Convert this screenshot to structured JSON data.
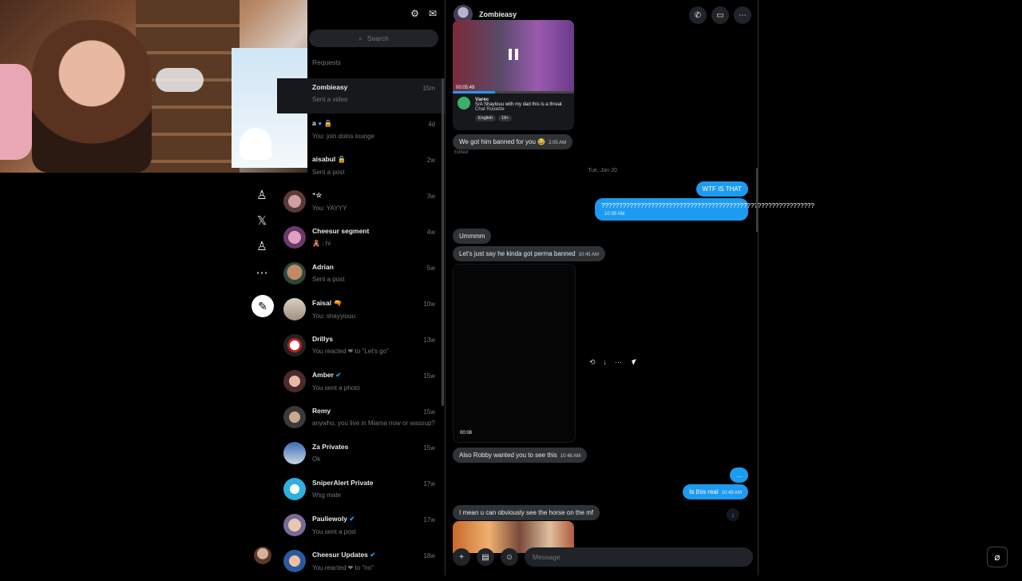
{
  "list": {
    "search_placeholder": "Search",
    "requests_label": "Requests",
    "conversations": [
      {
        "name": "Zombieasy",
        "preview": "Sent a video",
        "time": "15m"
      },
      {
        "name": "a",
        "preview": "You: join dolos lounge",
        "time": "4d"
      },
      {
        "name": "aisabul",
        "preview": "Sent a post",
        "time": "2w"
      },
      {
        "name": "",
        "preview": "You: YAYYY",
        "time": "3w"
      },
      {
        "name": "Cheesur segment",
        "preview": ": hi",
        "time": "4w"
      },
      {
        "name": "Adrian",
        "preview": "Sent a post",
        "time": "5w"
      },
      {
        "name": "Faisal",
        "preview": "You: shayyiouu",
        "time": "10w"
      },
      {
        "name": "Drillys",
        "preview": "You reacted ❤ to \"Let's go\"",
        "time": "13w"
      },
      {
        "name": "Amber",
        "preview": "You sent a photo",
        "time": "15w"
      },
      {
        "name": "Remy",
        "preview": "anywho, you live in Miama now or wassup?",
        "time": "15w"
      },
      {
        "name": "Za Privates",
        "preview": "Ok",
        "time": "15w"
      },
      {
        "name": "SniperAlert Private",
        "preview": "Wsg mate",
        "time": "17w"
      },
      {
        "name": "Pauliewoly",
        "preview": "You sent a post",
        "time": "17w"
      },
      {
        "name": "Cheesur Updates",
        "preview": "You reacted ❤ to \"no\"",
        "time": "18w"
      }
    ]
  },
  "chat": {
    "contact_name": "Zombieasy",
    "video_card": {
      "duration": "00:05:49",
      "streamer": "Varec",
      "stream_title": "S/A Shaylouu with my dad this is a threat",
      "category": "Chat Roulette",
      "tags": [
        "English",
        "18+"
      ]
    },
    "messages": {
      "m1": {
        "text": "We got him banned for you 😂",
        "time": "2:05 AM"
      },
      "edited": "Edited",
      "date": "Tue, Jan 20",
      "m2": {
        "text": "WTF IS THAT"
      },
      "m3": {
        "text": "????????????????????????????????????????????????????????????",
        "time": "10:39 AM"
      },
      "m4": {
        "text": "Ummmm"
      },
      "m5": {
        "text": "Let's just say he kinda got perma banned",
        "time": "10:45 AM"
      },
      "video_duration": "00:08",
      "m6": {
        "text": "Also Robby wanted you to see this",
        "time": "10:48 AM"
      },
      "m7": {
        "text": "..."
      },
      "m8": {
        "text": "Is this real",
        "time": "10:49 AM"
      },
      "m9": {
        "text": "I mean u can obviously see the horse on the mf"
      }
    },
    "composer_placeholder": "Message"
  },
  "colors": {
    "accent": "#1d9bf0",
    "bubble_in": "#2f3336",
    "bg": "#000000"
  }
}
